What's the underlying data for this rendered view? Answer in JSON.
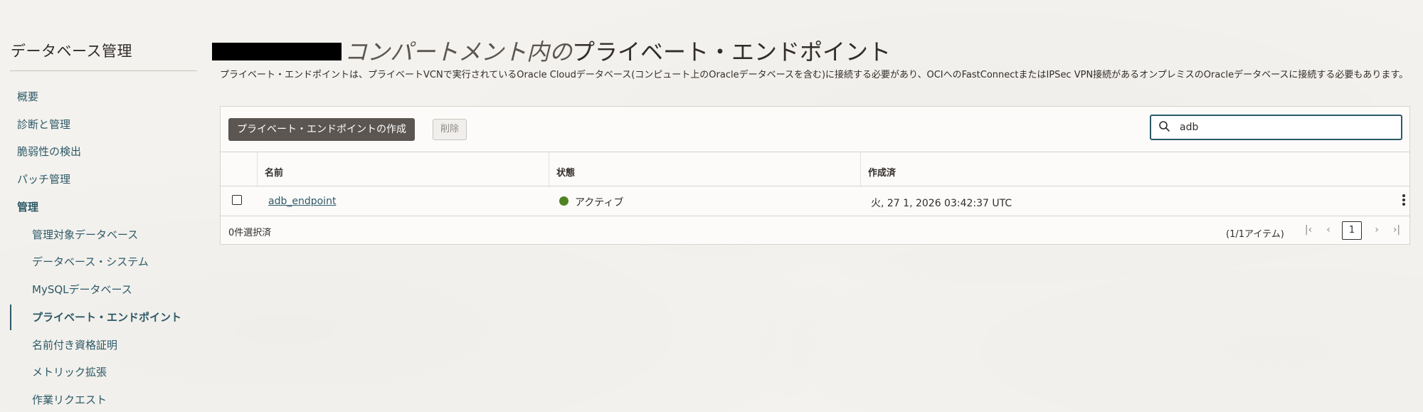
{
  "sidebar": {
    "title": "データベース管理",
    "items": [
      {
        "label": "概要"
      },
      {
        "label": "診断と管理"
      },
      {
        "label": "脆弱性の検出"
      },
      {
        "label": "パッチ管理"
      },
      {
        "label": "管理"
      },
      {
        "label": "管理対象データベース"
      },
      {
        "label": "データベース・システム"
      },
      {
        "label": "MySQLデータベース"
      },
      {
        "label": "プライベート・エンドポイント"
      },
      {
        "label": "名前付き資格証明"
      },
      {
        "label": "メトリック拡張"
      },
      {
        "label": "作業リクエスト"
      }
    ]
  },
  "header": {
    "title_italic": "コンパートメント内の",
    "title_main": "プライベート・エンドポイント",
    "description": "プライベート・エンドポイントは、プライベートVCNで実行されているOracle Cloudデータベース(コンピュート上のOracleデータベースを含む)に接続する必要があり、OCIへのFastConnectまたはIPSec VPN接続があるオンプレミスのOracleデータベースに接続する必要もあります。"
  },
  "toolbar": {
    "create_label": "プライベート・エンドポイントの作成",
    "delete_label": "削除",
    "search_value": "adb"
  },
  "table": {
    "columns": {
      "name": "名前",
      "status": "状態",
      "created": "作成済"
    },
    "rows": [
      {
        "name": "adb_endpoint",
        "status": "アクティブ",
        "created": "火, 27 1, 2026 03:42:37 UTC"
      }
    ]
  },
  "footer": {
    "selected": "0件選択済",
    "count": "(1/1アイテム)",
    "current_page": "1"
  },
  "colors": {
    "accent": "#2c5967",
    "status_active": "#508223",
    "button_primary": "#5b5652"
  }
}
